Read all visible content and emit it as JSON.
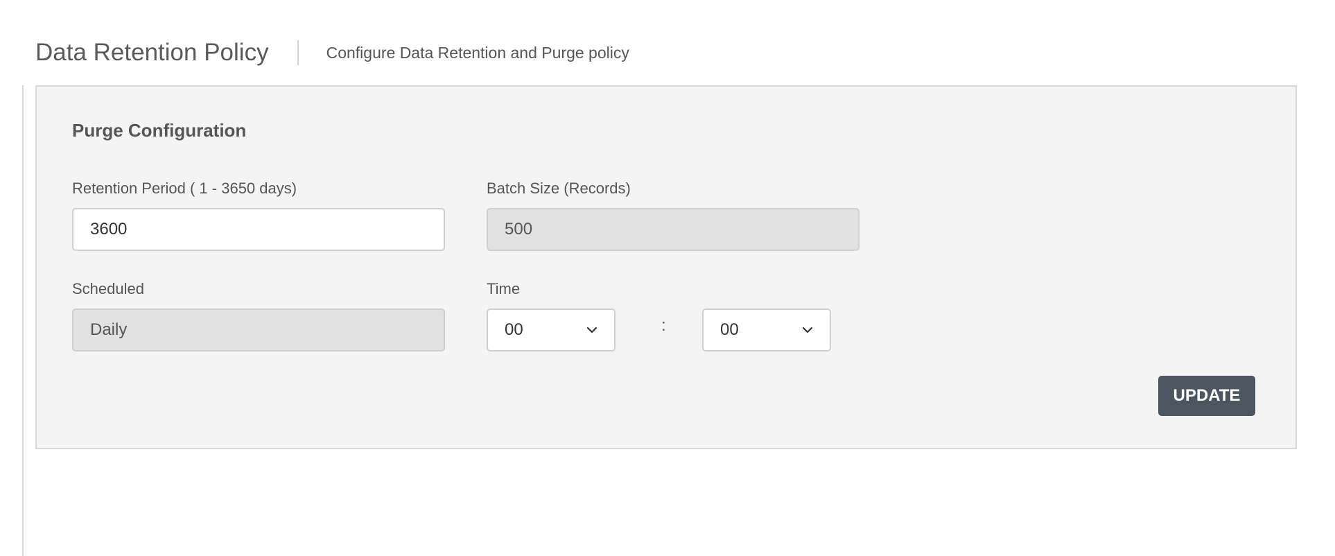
{
  "header": {
    "title": "Data Retention Policy",
    "subtitle": "Configure Data Retention and Purge policy"
  },
  "panel": {
    "section_title": "Purge Configuration",
    "retention": {
      "label": "Retention Period ( 1 - 3650 days)",
      "value": "3600"
    },
    "batch_size": {
      "label": "Batch Size (Records)",
      "value": "500"
    },
    "scheduled": {
      "label": "Scheduled",
      "value": "Daily"
    },
    "time": {
      "label": "Time",
      "hour": "00",
      "separator": ":",
      "minute": "00"
    },
    "update_label": "UPDATE"
  },
  "icons": {
    "dropdown": "chevron-down-icon"
  },
  "colors": {
    "button_bg": "#4d5561",
    "panel_bg": "#f4f4f4",
    "disabled_input_bg": "#e1e1e1"
  }
}
